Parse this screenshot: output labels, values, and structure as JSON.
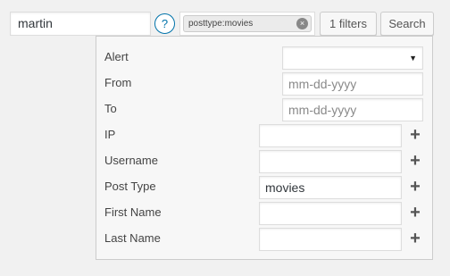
{
  "search": {
    "value": "martin"
  },
  "help": {
    "label": "?"
  },
  "filter_tag": {
    "label": "posttype:movies",
    "close": "×"
  },
  "toolbar": {
    "filters_label": "1 filters",
    "search_label": "Search"
  },
  "panel": {
    "rows": [
      {
        "label": "Alert",
        "value": "",
        "type": "select",
        "arrow": "▼"
      },
      {
        "label": "From",
        "placeholder": "mm-dd-yyyy"
      },
      {
        "label": "To",
        "placeholder": "mm-dd-yyyy"
      },
      {
        "label": "IP",
        "value": "",
        "plus": "+"
      },
      {
        "label": "Username",
        "value": "",
        "plus": "+"
      },
      {
        "label": "Post Type",
        "value": "movies",
        "plus": "+"
      },
      {
        "label": "First Name",
        "value": "",
        "plus": "+"
      },
      {
        "label": "Last Name",
        "value": "",
        "plus": "+"
      }
    ]
  },
  "colors": {
    "accent": "#0073aa",
    "background": "#f1f1f1"
  }
}
